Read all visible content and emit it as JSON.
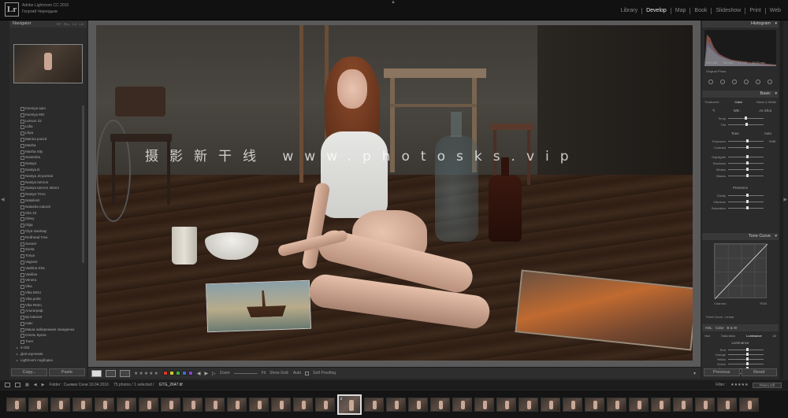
{
  "app": {
    "logo": "Lr",
    "title": "Adobe Lightroom CC 2015",
    "user": "Георгий Чернядьев"
  },
  "modules": [
    {
      "label": "Library"
    },
    {
      "label": "Develop"
    },
    {
      "label": "Map"
    },
    {
      "label": "Book"
    },
    {
      "label": "Slideshow"
    },
    {
      "label": "Print"
    },
    {
      "label": "Web"
    }
  ],
  "active_module": "Develop",
  "navigator": {
    "label": "Navigator",
    "options": [
      "FIT",
      "FILL",
      "1:1",
      "1:2"
    ]
  },
  "folders": [
    "Kseniya auto",
    "Kseniya MG",
    "Lesson 22",
    "Lidia",
    "Liliya",
    "Marina poezd",
    "Masha",
    "Masha Sity",
    "Nastenka",
    "Nastya",
    "Nastya B",
    "Nastya Jit portrait",
    "Nastya tamron",
    "Nastya tamron 35mm",
    "Nastya Tmro",
    "Natalivint",
    "Natasha natural",
    "Oks 24",
    "Olesy",
    "Olga",
    "Olya Ivantsay",
    "Redhead Tree",
    "Sunset",
    "Sveta",
    "Tonya",
    "Vagrant",
    "Vasilina Kha",
    "Vasilisa",
    "Venera",
    "Vika",
    "Vika MGU",
    "Vika polet",
    "Vika Retro",
    "Альтаграф",
    "Бутовская",
    "новс",
    "Маша набережная лихиденко",
    "Олель Кукла",
    "Тоня"
  ],
  "subfolders": [
    "3-Old",
    "Для изучения",
    "Lightroom подборка"
  ],
  "left_buttons": {
    "copy": "Copy...",
    "paste": "Paste"
  },
  "watermark": "摄影新干线 www.photosks.vip",
  "toolbar": {
    "stars": "★★★★★",
    "labels": [
      "#d8342c",
      "#d6c62c",
      "#3fb03c",
      "#3a6fd6",
      "#8a3fd6"
    ],
    "zoom": "Zoom",
    "fit": "Fit",
    "show_grid": "Show Grid:",
    "grid_value": "Auto",
    "soft_proofing": "Soft Proofing"
  },
  "histogram": {
    "label": "Histogram",
    "iso": "ISO 160",
    "focal": "35 mm",
    "aperture": "f / 1.8",
    "shutter": "1/200 sec",
    "original": "Original Photo"
  },
  "basic": {
    "label": "Basic",
    "treatment_label": "Treatment :",
    "color": "Color",
    "bw": "Black & White",
    "wb_label": "WB :",
    "wb_value": "As Shot",
    "temp": "Temp",
    "tint": "Tint",
    "tone_label": "Tone",
    "auto": "Auto",
    "exposure": "Exposure",
    "exposure_value": "0.00",
    "contrast": "Contrast",
    "highlights": "Highlights",
    "shadows": "Shadows",
    "whites": "Whites",
    "blacks": "Blacks",
    "presence_label": "Presence",
    "clarity": "Clarity",
    "vibrance": "Vibrance",
    "saturation": "Saturation"
  },
  "tone_curve": {
    "label": "Tone Curve",
    "channel_label": "Channel :",
    "channel_value": "RGB",
    "point_curve_label": "Point Curve :",
    "point_curve_value": "Linear"
  },
  "hsl": {
    "hsl": "HSL",
    "color": "Color",
    "bw": "B & W",
    "hue": "Hue",
    "saturation": "Saturation",
    "luminance": "Luminance",
    "all": "All",
    "group_label": "Luminance",
    "rows": [
      "Red",
      "Orange",
      "Yellow",
      "Green",
      "Aqua",
      "Blue"
    ]
  },
  "right_buttons": {
    "previous": "Previous",
    "reset": "Reset"
  },
  "filmbar": {
    "pages": [
      "1",
      "2"
    ],
    "source": "Folder : Сьемки Сени 10.04.2016",
    "count": "75 photos / 1 selected /",
    "filename": "GTG_2647.tif",
    "filter_label": "Filter :",
    "filters_off": "Filters Off"
  },
  "filmstrip_count": 34,
  "filmstrip_selected": 15,
  "filmstrip_badge": "2"
}
